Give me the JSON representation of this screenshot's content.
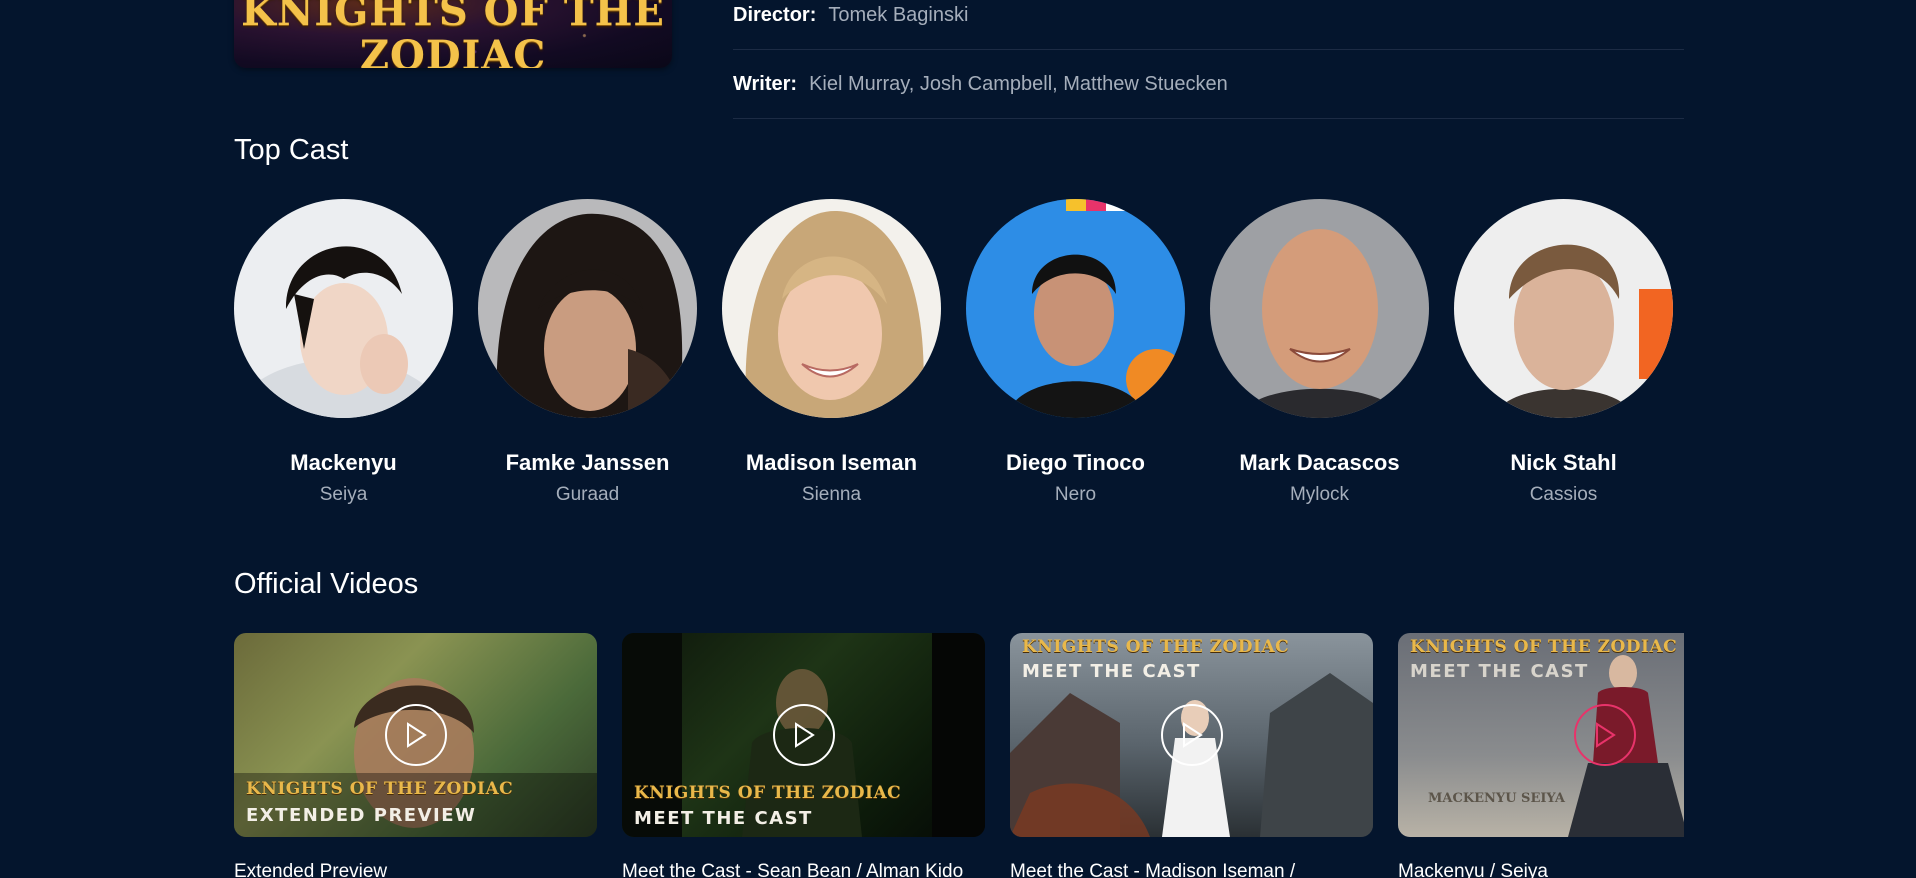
{
  "poster": {
    "logo_text": "KNIGHTS OF THE ZODIAC"
  },
  "crew": {
    "director_label": "Director:",
    "director_value": "Tomek Baginski",
    "writer_label": "Writer:",
    "writer_value": "Kiel Murray, Josh Campbell, Matthew Stuecken"
  },
  "sections": {
    "top_cast": "Top Cast",
    "official_videos": "Official Videos"
  },
  "cast": [
    {
      "name": "Mackenyu",
      "role": "Seiya"
    },
    {
      "name": "Famke Janssen",
      "role": "Guraad"
    },
    {
      "name": "Madison Iseman",
      "role": "Sienna"
    },
    {
      "name": "Diego Tinoco",
      "role": "Nero"
    },
    {
      "name": "Mark Dacascos",
      "role": "Mylock"
    },
    {
      "name": "Nick Stahl",
      "role": "Cassios"
    }
  ],
  "videos": [
    {
      "title": "Extended Preview",
      "brand": "KNIGHTS OF THE ZODIAC",
      "caption": "EXTENDED PREVIEW"
    },
    {
      "title": "Meet the Cast - Sean Bean / Alman Kido",
      "brand": "KNIGHTS OF THE ZODIAC",
      "caption": "MEET THE CAST"
    },
    {
      "title": "Meet the Cast - Madison Iseman /",
      "brand": "KNIGHTS OF THE ZODIAC",
      "caption": "MEET THE CAST"
    },
    {
      "title": "Mackenyu / Seiya",
      "brand": "KNIGHTS OF THE ZODIAC",
      "caption": "MEET THE CAST",
      "watermark": "MACKENYU SEIYA"
    }
  ],
  "icons": {
    "play": "play-icon"
  },
  "colors": {
    "background": "#04152d",
    "muted_text": "#a5aebb",
    "accent_pink": "#e8336a",
    "divider": "#1c2b44"
  }
}
